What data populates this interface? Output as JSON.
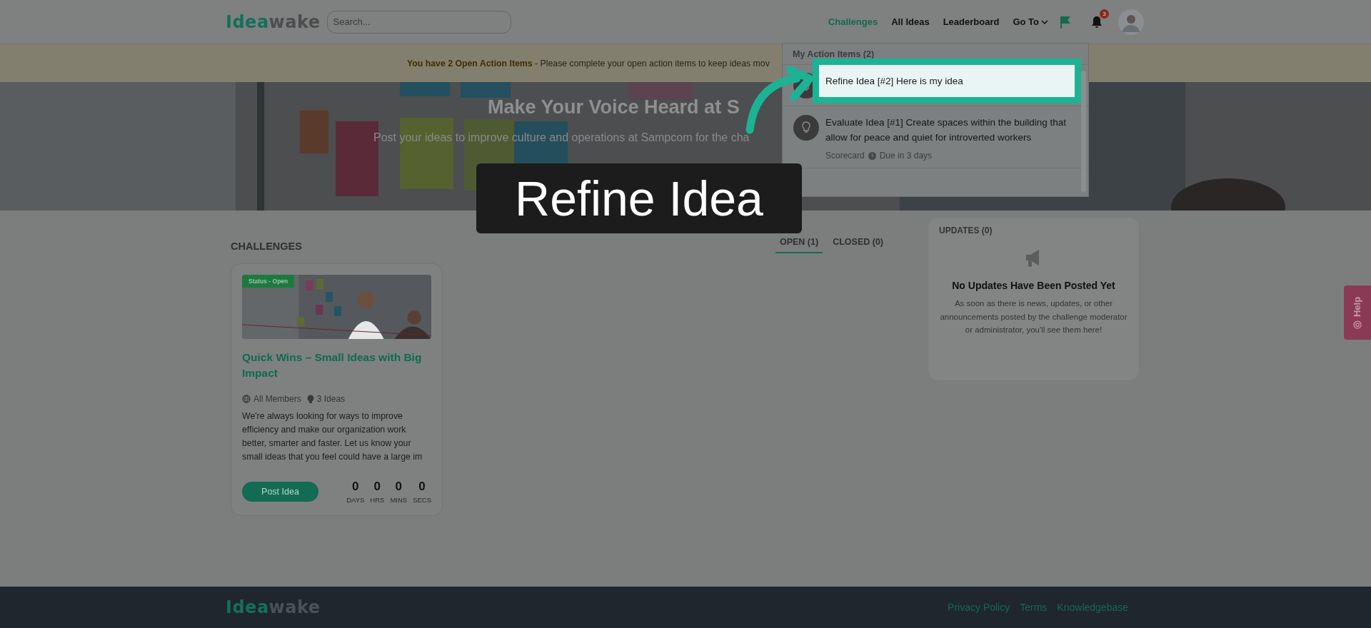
{
  "header": {
    "logo": {
      "part_1": "Idea",
      "part_2": "wake"
    },
    "search": {
      "placeholder": "Search..."
    },
    "nav": [
      {
        "label": "Challenges",
        "selected": true
      },
      {
        "label": "All Ideas",
        "selected": false
      },
      {
        "label": "Leaderboard",
        "selected": false
      },
      {
        "label": "Go To",
        "selected": false,
        "kind": "dropdown"
      }
    ],
    "notifications_badge": "3"
  },
  "banner": {
    "text": "**You have 2 Open Action Items** - Please complete your open action items to keep ideas mov"
  },
  "hero": {
    "title": "Make Your Voice Heard at S",
    "subtitle": "Post your ideas to improve culture and operations at Sampcom for the cha"
  },
  "action_items": {
    "title": "My Action Items (2)",
    "items": [
      {
        "kind": "hidden"
      },
      {
        "kind": "full",
        "text": "Evaluate Idea [#1] Create spaces within the building that allow for peace and quiet for introverted workers",
        "type": "Scorecard",
        "due": "Due in 3 days"
      }
    ]
  },
  "tutorial": {
    "highlight_text": "Refine Idea [#2] Here is my idea",
    "caption": "Refine Idea"
  },
  "challenges": {
    "title": "CHALLENGES",
    "tabs": [
      {
        "label": "OPEN (1)",
        "selected": true
      },
      {
        "label": "CLOSED (0)",
        "selected": false
      }
    ],
    "cards": [
      {
        "status": "Status - Open",
        "title": "Quick Wins – Small Ideas with Big Impact",
        "audience": "All Members",
        "ideas": "3 Ideas",
        "description": "We're always looking for ways to improve efficiency and make our organization work better, smarter and faster. Let us know your small ideas that you feel could have a large im",
        "button": "Post Idea",
        "countdown": [
          {
            "value": "0",
            "unit": "DAYS"
          },
          {
            "value": "0",
            "unit": "HRS"
          },
          {
            "value": "0",
            "unit": "MINS"
          },
          {
            "value": "0",
            "unit": "SECS"
          }
        ]
      }
    ]
  },
  "updates": {
    "title": "UPDATES (0)",
    "heading": "No Updates Have Been Posted Yet",
    "body": "As soon as there is news, updates, or other announcements posted by the challenge moderator or administrator, you'll see them here!"
  },
  "help_tab": "Help",
  "footer": {
    "logo": {
      "part_1": "Idea",
      "part_2": "wake"
    },
    "links": [
      "Privacy Policy",
      "Terms",
      "Knowledgebase"
    ]
  }
}
